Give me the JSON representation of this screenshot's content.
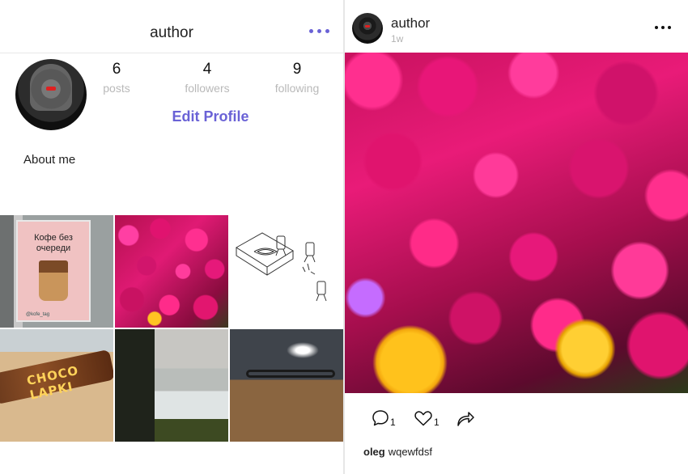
{
  "profile": {
    "title": "author",
    "stats": [
      {
        "value": "6",
        "label": "posts"
      },
      {
        "value": "4",
        "label": "followers"
      },
      {
        "value": "9",
        "label": "following"
      }
    ],
    "edit_label": "Edit Profile",
    "about": "About me",
    "poster_text": "Кофе без очереди",
    "poster_tag": "@kofe_tag",
    "choco_text": "CHOCO LAPKI",
    "icons": {
      "menu": "more-dots-icon"
    }
  },
  "post": {
    "author": "author",
    "time": "1w",
    "comments": "1",
    "likes": "1",
    "caption_user": "oleg",
    "caption_text": "wqewfdsf",
    "icons": {
      "comment": "comment-icon",
      "like": "heart-icon",
      "share": "share-arrow-icon",
      "menu": "more-dots-icon"
    }
  },
  "colors": {
    "accent": "#6a62d6",
    "muted": "#b9b9b9",
    "divider": "#e8e8e8"
  }
}
